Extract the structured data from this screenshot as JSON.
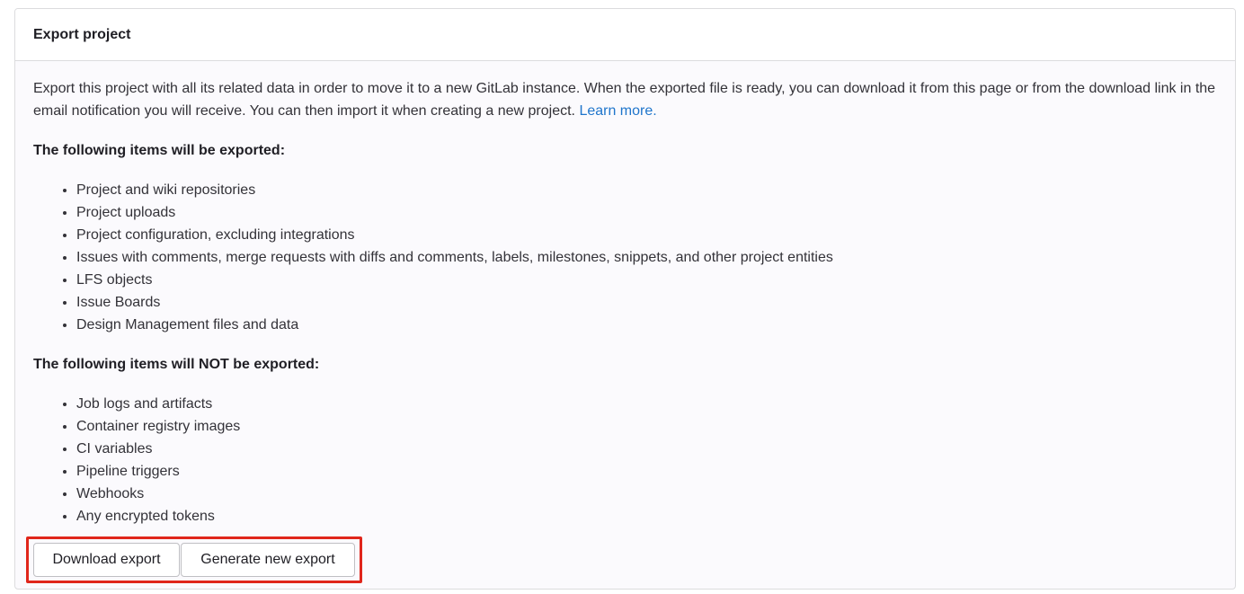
{
  "card": {
    "title": "Export project",
    "intro_text": "Export this project with all its related data in order to move it to a new GitLab instance. When the exported file is ready, you can download it from this page or from the download link in the email notification you will receive. You can then import it when creating a new project. ",
    "learn_more_label": "Learn more.",
    "exported_heading": "The following items will be exported:",
    "exported_items": [
      "Project and wiki repositories",
      "Project uploads",
      "Project configuration, excluding integrations",
      "Issues with comments, merge requests with diffs and comments, labels, milestones, snippets, and other project entities",
      "LFS objects",
      "Issue Boards",
      "Design Management files and data"
    ],
    "not_exported_heading": "The following items will NOT be exported:",
    "not_exported_items": [
      "Job logs and artifacts",
      "Container registry images",
      "CI variables",
      "Pipeline triggers",
      "Webhooks",
      "Any encrypted tokens"
    ],
    "download_label": "Download export",
    "generate_label": "Generate new export"
  },
  "colors": {
    "link": "#1f75cb",
    "highlight": "#e0261b",
    "border": "#dcdcde",
    "body_bg": "#fbfafd"
  }
}
